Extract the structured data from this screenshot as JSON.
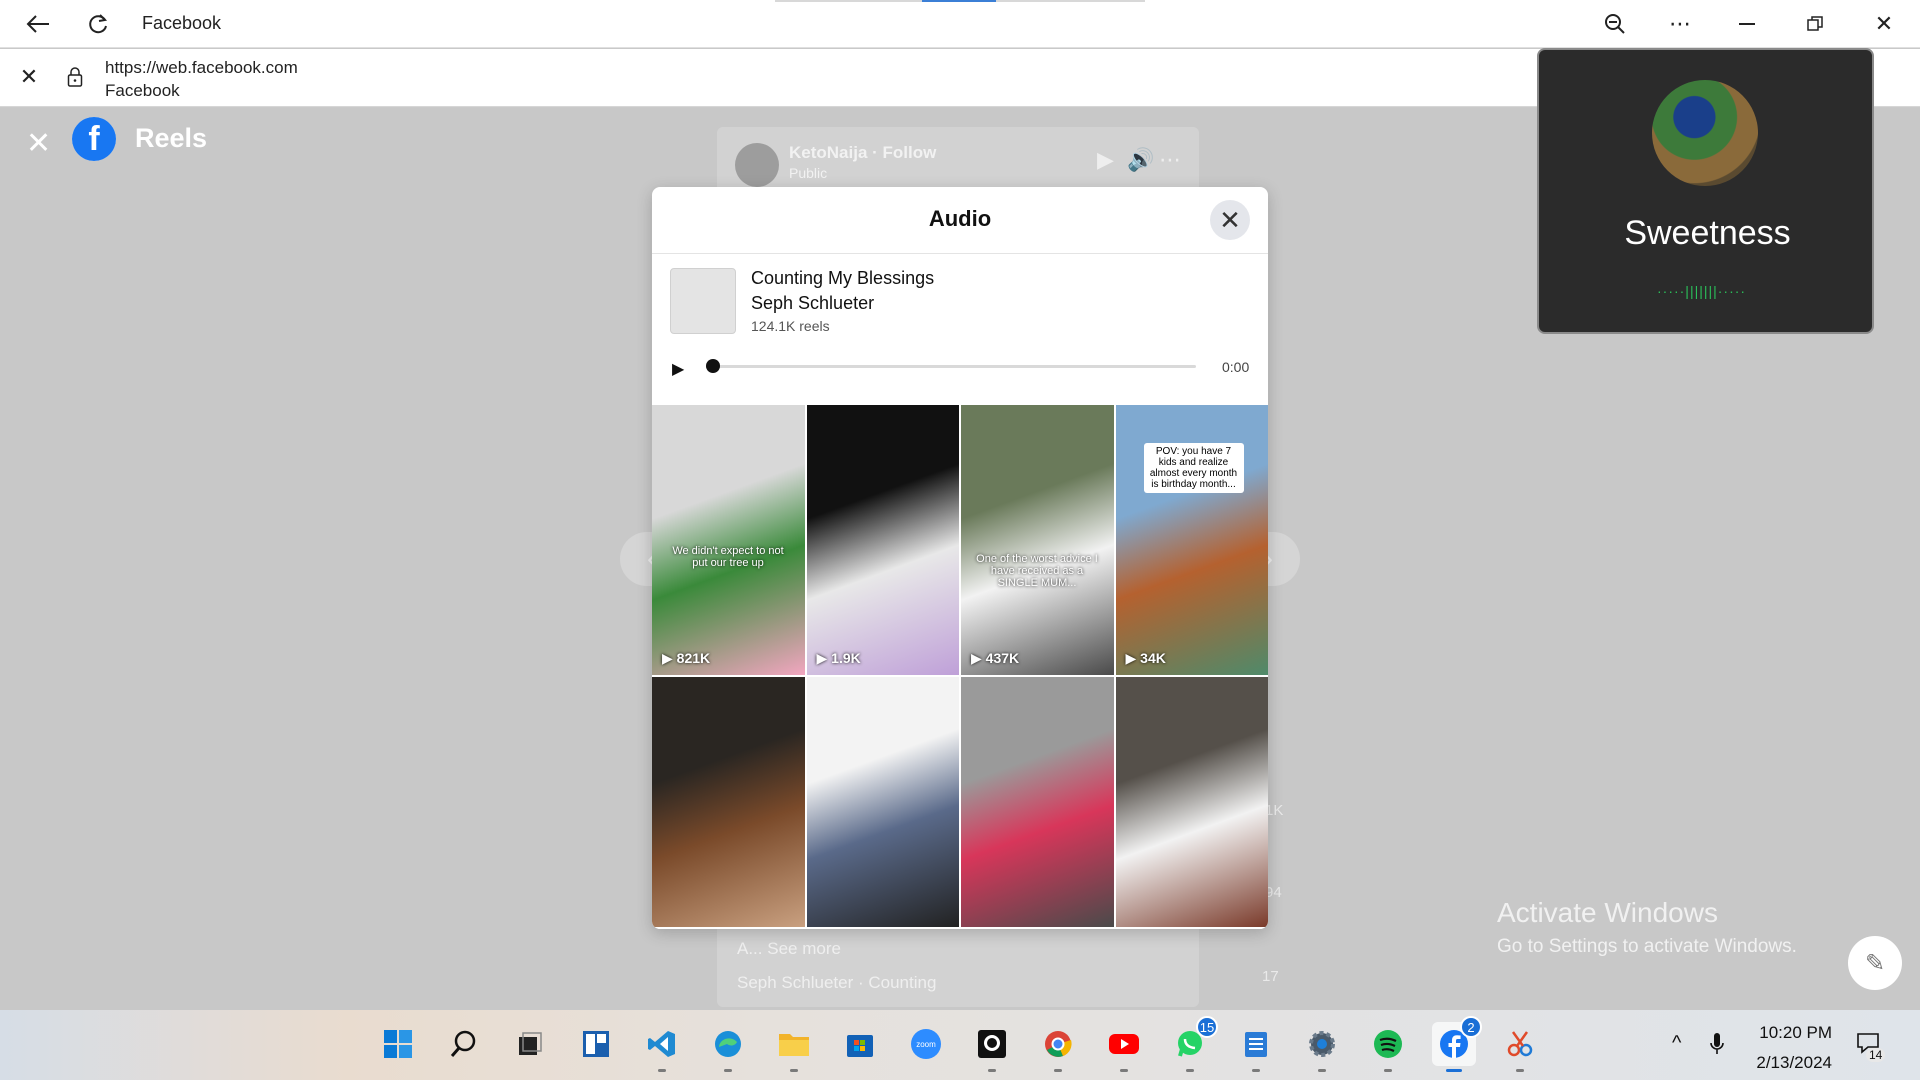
{
  "titlebar": {
    "title": "Facebook",
    "icons": [
      "back-icon",
      "refresh-icon",
      "zoom-out-icon",
      "more-icon",
      "minimize-icon",
      "restore-icon",
      "close-icon"
    ]
  },
  "addressbar": {
    "url": "https://web.facebook.com",
    "page_title": "Facebook"
  },
  "reels": {
    "header_title": "Reels",
    "bg_reel": {
      "author": "KetoNaija · Follow",
      "visibility": "Public",
      "caption_more": "A... See more",
      "audio_line": "Seph Schlueter · Counting",
      "share_count": "17",
      "like_count": "1K",
      "comment_count": "94"
    }
  },
  "audio_modal": {
    "title": "Audio",
    "song_title": "Counting My Blessings",
    "artist": "Seph Schlueter",
    "reels_count": "124.1K reels",
    "time": "0:00",
    "progress": 0,
    "tiles": [
      {
        "views": "821K",
        "caption": "We didn't expect to not put our tree up",
        "colors": [
          "#d8d8d8",
          "#3a8a3a",
          "#f2a6c0"
        ]
      },
      {
        "views": "1.9K",
        "caption": "",
        "colors": [
          "#111111",
          "#e8e8e8",
          "#bfa0d8"
        ]
      },
      {
        "views": "437K",
        "caption": "One of the worst advice I have received as a SINGLE MUM...",
        "colors": [
          "#6a7a5a",
          "#f2f2f2",
          "#4a4a4a"
        ]
      },
      {
        "views": "34K",
        "caption": "POV: you have 7 kids and realize almost every month is birthday month...",
        "colors": [
          "#7fa9d0",
          "#b5612f",
          "#4f8a6a"
        ]
      },
      {
        "views": "",
        "caption": "",
        "colors": [
          "#2a2622",
          "#7a4a2a",
          "#c9a080"
        ]
      },
      {
        "views": "",
        "caption": "",
        "colors": [
          "#f3f3f3",
          "#5a6a8a",
          "#222222"
        ]
      },
      {
        "views": "",
        "caption": "",
        "colors": [
          "#9a9a9a",
          "#d8365a",
          "#4a4a4a"
        ]
      },
      {
        "views": "",
        "caption": "",
        "colors": [
          "#55504a",
          "#f2f2f2",
          "#7a3a2a"
        ]
      }
    ]
  },
  "call_popup": {
    "name": "Sweetness"
  },
  "watermark": {
    "line1": "Activate Windows",
    "line2": "Go to Settings to activate Windows."
  },
  "taskbar": {
    "time": "10:20 PM",
    "date": "2/13/2024",
    "notifications": "14",
    "apps": [
      {
        "name": "start-icon",
        "badge": ""
      },
      {
        "name": "search-icon",
        "badge": ""
      },
      {
        "name": "task-view-icon",
        "badge": ""
      },
      {
        "name": "widgets-icon",
        "badge": ""
      },
      {
        "name": "vscode-icon",
        "badge": ""
      },
      {
        "name": "edge-icon",
        "badge": ""
      },
      {
        "name": "file-explorer-icon",
        "badge": ""
      },
      {
        "name": "microsoft-store-icon",
        "badge": ""
      },
      {
        "name": "zoom-icon",
        "badge": ""
      },
      {
        "name": "github-icon",
        "badge": ""
      },
      {
        "name": "chrome-icon",
        "badge": ""
      },
      {
        "name": "youtube-icon",
        "badge": ""
      },
      {
        "name": "whatsapp-icon",
        "badge": "15"
      },
      {
        "name": "notepad-icon",
        "badge": ""
      },
      {
        "name": "settings-icon",
        "badge": ""
      },
      {
        "name": "spotify-icon",
        "badge": ""
      },
      {
        "name": "facebook-icon",
        "badge": "2"
      },
      {
        "name": "snipping-tool-icon",
        "badge": ""
      }
    ]
  }
}
